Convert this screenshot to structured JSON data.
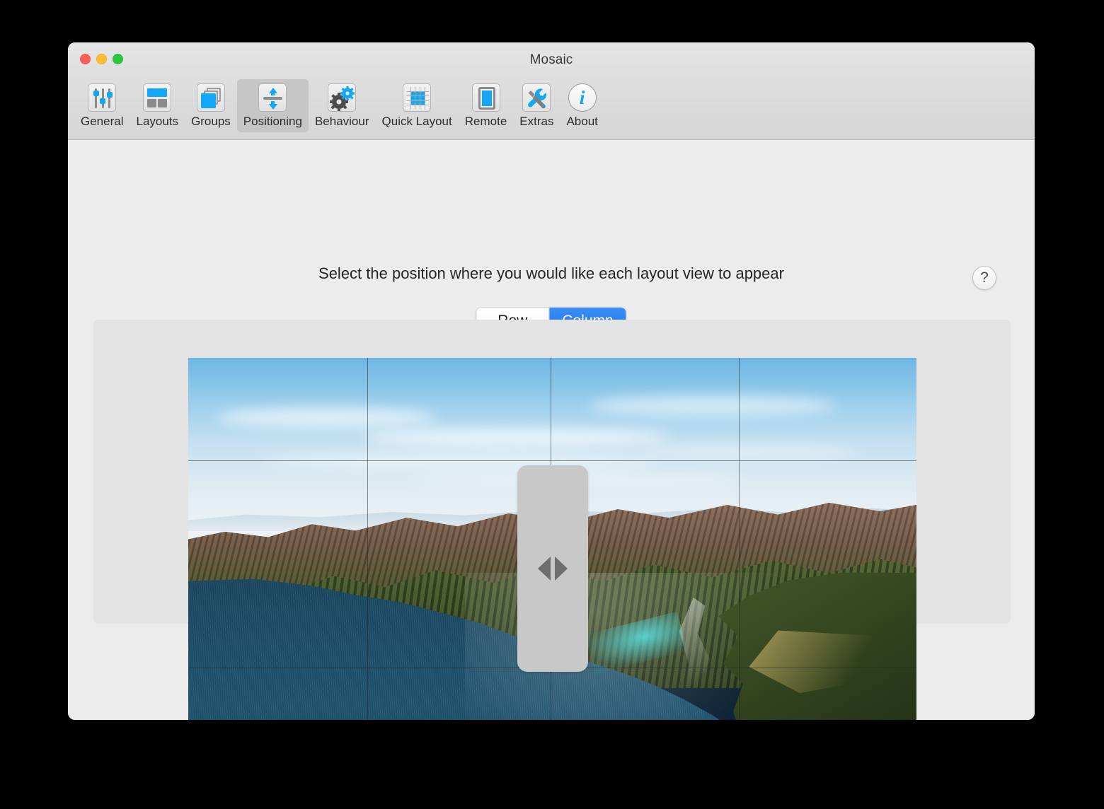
{
  "window": {
    "title": "Mosaic",
    "traffic_lights": [
      {
        "name": "close",
        "color": "#ff5f57"
      },
      {
        "name": "minimize",
        "color": "#febc2e"
      },
      {
        "name": "maximize",
        "color": "#28c840"
      }
    ]
  },
  "toolbar": {
    "selected": "Positioning",
    "items": [
      {
        "label": "General",
        "icon": "sliders-icon"
      },
      {
        "label": "Layouts",
        "icon": "layouts-grid-icon"
      },
      {
        "label": "Groups",
        "icon": "stacked-squares-icon"
      },
      {
        "label": "Positioning",
        "icon": "vertical-arrows-icon"
      },
      {
        "label": "Behaviour",
        "icon": "gears-icon"
      },
      {
        "label": "Quick Layout",
        "icon": "grid-icon"
      },
      {
        "label": "Remote",
        "icon": "device-screen-icon"
      },
      {
        "label": "Extras",
        "icon": "wrench-screwdriver-icon"
      },
      {
        "label": "About",
        "icon": "info-circle-icon"
      }
    ]
  },
  "content": {
    "instruction": "Select the position where you would like each layout view to appear",
    "help_label": "?",
    "segmented": {
      "options": [
        "Row",
        "Column"
      ],
      "selected": "Column",
      "row_label": "Row",
      "column_label": "Column",
      "accent_color": "#1c70ef"
    },
    "preview": {
      "wallpaper_name": "big-sur-coastline",
      "handle_icon": "horizontal-resize-arrows-icon",
      "handle_color": "#c8c8c8",
      "divider_positions": {
        "vertical_percent": [
          24.6,
          49.8,
          75.6
        ],
        "horizontal_percent": [
          24.8,
          75.0
        ]
      }
    }
  }
}
